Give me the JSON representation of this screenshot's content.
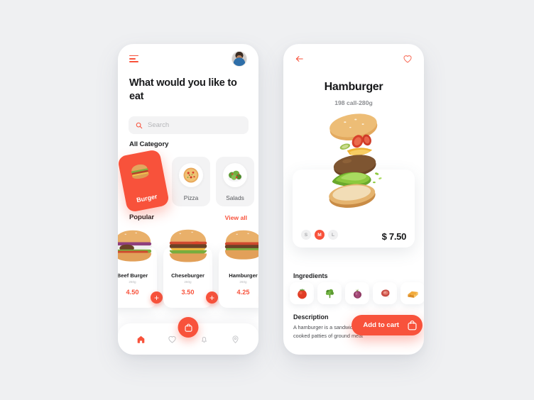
{
  "theme": {
    "accent": "#f8523b",
    "background": "#eff0f2",
    "card": "#ffffff",
    "muted_text": "#8b8d91"
  },
  "home": {
    "menu_icon": "hamburger-menu-icon",
    "avatar_alt": "user-avatar",
    "headline": "What would you like to eat",
    "search": {
      "placeholder": "Search",
      "value": "",
      "icon": "search-icon"
    },
    "category_section_title": "All Category",
    "categories": [
      {
        "label": "Burger",
        "icon": "burger-photo",
        "active": true
      },
      {
        "label": "Pizza",
        "icon": "pizza-photo",
        "active": false
      },
      {
        "label": "Salads",
        "icon": "salad-photo",
        "active": false
      }
    ],
    "popular_title": "Popular",
    "view_all_label": "View all",
    "popular_items": [
      {
        "name": "Beef Burger",
        "weight": "260g",
        "price": "4.50",
        "add_label": "+"
      },
      {
        "name": "Cheseburger",
        "weight": "260g",
        "price": "3.50",
        "add_label": "+"
      },
      {
        "name": "Hamburger",
        "weight": "260g",
        "price": "4.25",
        "add_label": "+"
      }
    ],
    "bottom_nav": [
      {
        "icon": "home-icon",
        "active": true
      },
      {
        "icon": "heart-icon",
        "active": false
      },
      {
        "icon": "shopping-bag-icon",
        "active": false,
        "fab": true
      },
      {
        "icon": "bell-icon",
        "active": false
      },
      {
        "icon": "location-pin-icon",
        "active": false
      }
    ]
  },
  "detail": {
    "back_icon": "back-arrow-icon",
    "favorite_icon": "heart-outline-icon",
    "title": "Hamburger",
    "subtitle": "198 call-280g",
    "hero_image_alt": "exploded-hamburger-photo",
    "sizes": [
      {
        "label": "S",
        "active": false
      },
      {
        "label": "M",
        "active": true
      },
      {
        "label": "L",
        "active": false
      }
    ],
    "price": "$ 7.50",
    "ingredients_title": "Ingredients",
    "ingredients": [
      {
        "name": "tomato-icon"
      },
      {
        "name": "lettuce-icon"
      },
      {
        "name": "onion-icon"
      },
      {
        "name": "meat-icon"
      },
      {
        "name": "cheese-icon"
      }
    ],
    "description_title": "Description",
    "description_text": "A hamburger is a sandwich consisting of one or more cooked patties of ground meat",
    "add_to_cart_label": "Add to cart",
    "add_to_cart_icon": "shopping-bag-icon"
  }
}
